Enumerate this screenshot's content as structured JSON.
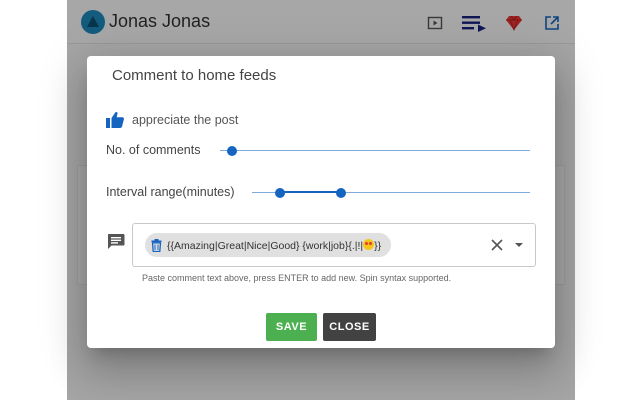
{
  "header": {
    "user_name": "Jonas Jonas",
    "icons": [
      "play-icon",
      "playlist-icon",
      "gem-icon",
      "open-external-icon"
    ]
  },
  "dialog": {
    "title": "Comment to home feeds",
    "appreciate_label": "appreciate the post",
    "comments_label": "No. of comments",
    "comments_value_fraction": 0.04,
    "interval_label": "Interval range(minutes)",
    "interval_range_fraction": [
      0.1,
      0.32
    ],
    "chip_text": "{{Amazing|Great|Nice|Good} {work|job}{.|!|",
    "chip_suffix": "}}",
    "hint": "Paste comment text above, press ENTER to add new. Spin syntax supported.",
    "save_label": "SAVE",
    "close_label": "CLOSE"
  },
  "colors": {
    "accent": "#1565c0",
    "save": "#4caf50",
    "close": "#424242",
    "gem": "#e53935"
  }
}
